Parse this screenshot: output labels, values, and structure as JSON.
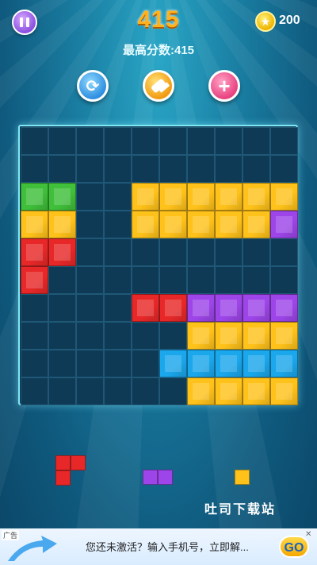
{
  "header": {
    "score": "415",
    "best_label": "最高分数:415",
    "coins": "200",
    "pause_icon": "pause-icon",
    "coin_icon": "star-coin-icon"
  },
  "tools": [
    {
      "name": "refresh-tool",
      "icon": "refresh-icon",
      "glyph": "⟳"
    },
    {
      "name": "hammer-tool",
      "icon": "hammer-icon",
      "glyph": "🔨"
    },
    {
      "name": "add-tool",
      "icon": "plus-icon",
      "glyph": "+"
    }
  ],
  "board": {
    "size": 10,
    "colors": {
      "G": "#3fbf3a",
      "Y": "#ffc21a",
      "R": "#e82828",
      "P": "#9d45e8",
      "B": "#1aa7ec"
    },
    "rows": [
      "..........",
      "..........",
      "GG..YYYYYY",
      "YY..YYYYYP",
      "RR........",
      "R.........",
      "....RRPPPP",
      "......YYYY",
      ".....BBBBB",
      "......YYYY"
    ]
  },
  "pieces": [
    {
      "name": "piece-red",
      "color": "R",
      "cells": [
        [
          0,
          0
        ],
        [
          0,
          1
        ],
        [
          1,
          0
        ]
      ]
    },
    {
      "name": "piece-purple",
      "color": "P",
      "cells": [
        [
          0,
          0
        ],
        [
          0,
          1
        ]
      ]
    },
    {
      "name": "piece-yellow",
      "color": "Y",
      "cells": [
        [
          0,
          0
        ]
      ]
    }
  ],
  "watermark": "吐司下载站",
  "ad": {
    "tag": "广告",
    "text": "您还未激活？输入手机号，立即解...",
    "button": "GO",
    "close": "✕"
  }
}
